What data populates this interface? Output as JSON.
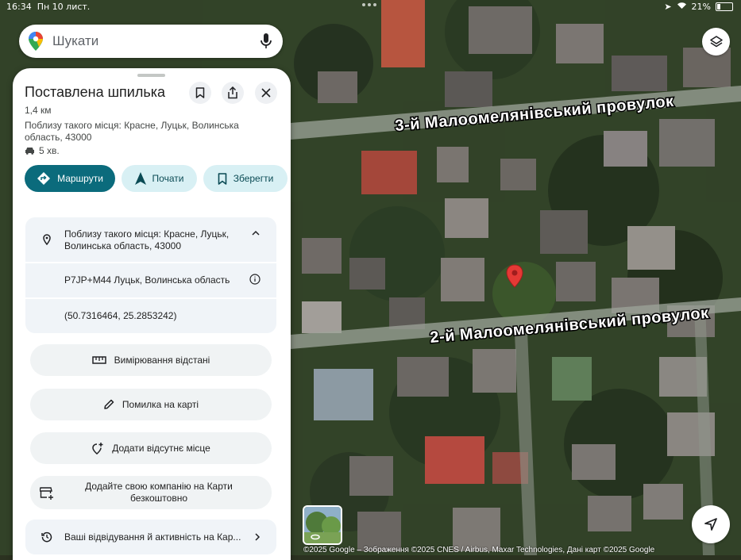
{
  "status": {
    "time": "16:34",
    "date": "Пн 10 лист.",
    "battery": "21%",
    "battery_level": 0.21
  },
  "search": {
    "placeholder": "Шукати"
  },
  "map": {
    "street_top": "3-й Малоомелянівський провулок",
    "street_bottom": "2-й Малоомелянівський провулок",
    "attribution": "©2025 Google – Зображення ©2025 CNES / Airbus, Maxar Technologies, Дані карт ©2025 Google"
  },
  "panel": {
    "title": "Поставлена шпилька",
    "distance": "1,4 км",
    "near": "Поблизу такого місця: Красне, Луцьк, Волинська область, 43000",
    "drive_time": "5 хв.",
    "actions": {
      "routes": "Маршрути",
      "start": "Почати",
      "save": "Зберегти"
    },
    "details": {
      "near": "Поблизу такого місця: Красне, Луцьк, Волинська область, 43000",
      "plus_code": "P7JP+M44 Луцьк, Волинська область",
      "coords": "(50.7316464, 25.2853242)"
    },
    "buttons": {
      "measure": "Вимірювання відстані",
      "report": "Помилка на карті",
      "add_place": "Додати відсутнє місце",
      "add_business": "Додайте свою компанію на Карти безкоштовно"
    },
    "activity": "Ваші відвідування й активність на Кар..."
  },
  "colors": {
    "primary": "#0b6b7c",
    "secondary": "#d8f0f4",
    "pin": "#e53935"
  }
}
